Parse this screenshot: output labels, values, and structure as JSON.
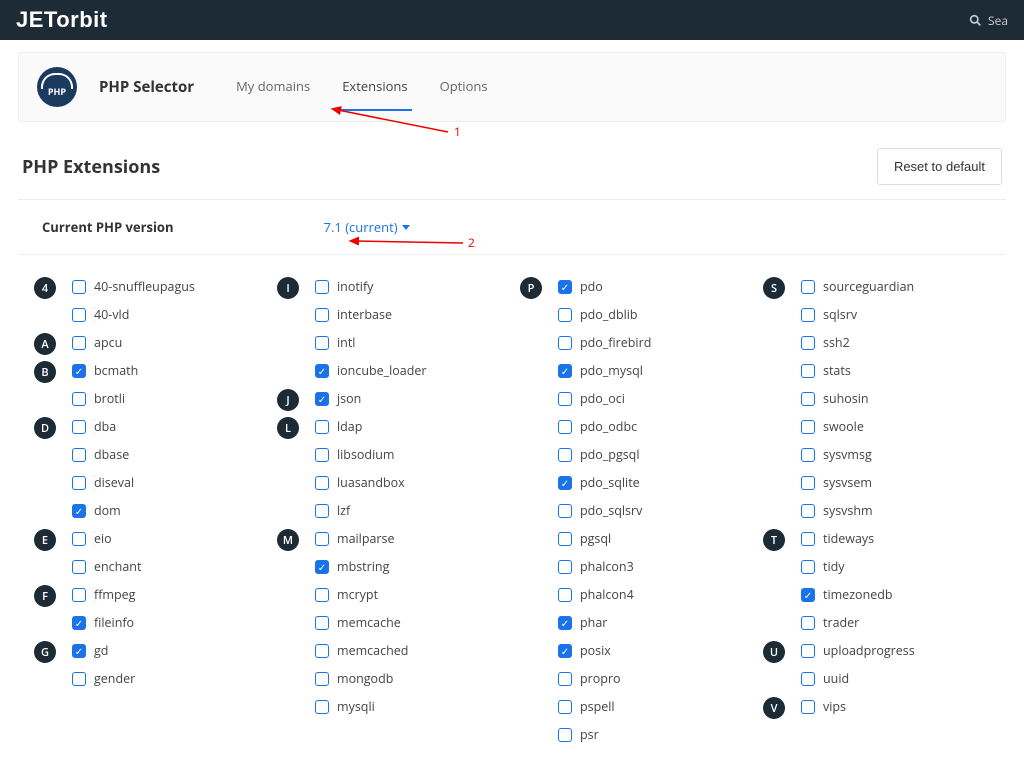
{
  "brand": "JETorbit",
  "search_placeholder": "Sea",
  "app": {
    "icon_text": "PHP",
    "title": "PHP Selector",
    "tabs": [
      {
        "label": "My domains",
        "active": false
      },
      {
        "label": "Extensions",
        "active": true
      },
      {
        "label": "Options",
        "active": false
      }
    ]
  },
  "page": {
    "title": "PHP Extensions",
    "reset_button": "Reset to default"
  },
  "version": {
    "label": "Current PHP version",
    "value": "7.1 (current)"
  },
  "annotations": {
    "a1": "1",
    "a2": "2"
  },
  "columns": [
    [
      {
        "letter": "4",
        "items": [
          {
            "name": "40-snuffleupagus",
            "checked": false
          },
          {
            "name": "40-vld",
            "checked": false
          }
        ]
      },
      {
        "letter": "A",
        "items": [
          {
            "name": "apcu",
            "checked": false
          }
        ]
      },
      {
        "letter": "B",
        "items": [
          {
            "name": "bcmath",
            "checked": true
          },
          {
            "name": "brotli",
            "checked": false
          }
        ]
      },
      {
        "letter": "D",
        "items": [
          {
            "name": "dba",
            "checked": false
          },
          {
            "name": "dbase",
            "checked": false
          },
          {
            "name": "diseval",
            "checked": false
          },
          {
            "name": "dom",
            "checked": true
          }
        ]
      },
      {
        "letter": "E",
        "items": [
          {
            "name": "eio",
            "checked": false
          },
          {
            "name": "enchant",
            "checked": false
          }
        ]
      },
      {
        "letter": "F",
        "items": [
          {
            "name": "ffmpeg",
            "checked": false
          },
          {
            "name": "fileinfo",
            "checked": true
          }
        ]
      },
      {
        "letter": "G",
        "items": [
          {
            "name": "gd",
            "checked": true
          },
          {
            "name": "gender",
            "checked": false
          }
        ]
      }
    ],
    [
      {
        "letter": "I",
        "items": [
          {
            "name": "inotify",
            "checked": false
          },
          {
            "name": "interbase",
            "checked": false
          },
          {
            "name": "intl",
            "checked": false
          },
          {
            "name": "ioncube_loader",
            "checked": true
          }
        ]
      },
      {
        "letter": "J",
        "items": [
          {
            "name": "json",
            "checked": true
          }
        ]
      },
      {
        "letter": "L",
        "items": [
          {
            "name": "ldap",
            "checked": false
          },
          {
            "name": "libsodium",
            "checked": false
          },
          {
            "name": "luasandbox",
            "checked": false
          },
          {
            "name": "lzf",
            "checked": false
          }
        ]
      },
      {
        "letter": "M",
        "items": [
          {
            "name": "mailparse",
            "checked": false
          },
          {
            "name": "mbstring",
            "checked": true
          },
          {
            "name": "mcrypt",
            "checked": false
          },
          {
            "name": "memcache",
            "checked": false
          },
          {
            "name": "memcached",
            "checked": false
          },
          {
            "name": "mongodb",
            "checked": false
          },
          {
            "name": "mysqli",
            "checked": false
          }
        ]
      }
    ],
    [
      {
        "letter": "P",
        "items": [
          {
            "name": "pdo",
            "checked": true
          },
          {
            "name": "pdo_dblib",
            "checked": false
          },
          {
            "name": "pdo_firebird",
            "checked": false
          },
          {
            "name": "pdo_mysql",
            "checked": true
          },
          {
            "name": "pdo_oci",
            "checked": false
          },
          {
            "name": "pdo_odbc",
            "checked": false
          },
          {
            "name": "pdo_pgsql",
            "checked": false
          },
          {
            "name": "pdo_sqlite",
            "checked": true
          },
          {
            "name": "pdo_sqlsrv",
            "checked": false
          },
          {
            "name": "pgsql",
            "checked": false
          },
          {
            "name": "phalcon3",
            "checked": false
          },
          {
            "name": "phalcon4",
            "checked": false
          },
          {
            "name": "phar",
            "checked": true
          },
          {
            "name": "posix",
            "checked": true
          },
          {
            "name": "propro",
            "checked": false
          },
          {
            "name": "pspell",
            "checked": false
          },
          {
            "name": "psr",
            "checked": false
          }
        ]
      }
    ],
    [
      {
        "letter": "S",
        "items": [
          {
            "name": "sourceguardian",
            "checked": false
          },
          {
            "name": "sqlsrv",
            "checked": false
          },
          {
            "name": "ssh2",
            "checked": false
          },
          {
            "name": "stats",
            "checked": false
          },
          {
            "name": "suhosin",
            "checked": false
          },
          {
            "name": "swoole",
            "checked": false
          },
          {
            "name": "sysvmsg",
            "checked": false
          },
          {
            "name": "sysvsem",
            "checked": false
          },
          {
            "name": "sysvshm",
            "checked": false
          }
        ]
      },
      {
        "letter": "T",
        "items": [
          {
            "name": "tideways",
            "checked": false
          },
          {
            "name": "tidy",
            "checked": false
          },
          {
            "name": "timezonedb",
            "checked": true
          },
          {
            "name": "trader",
            "checked": false
          }
        ]
      },
      {
        "letter": "U",
        "items": [
          {
            "name": "uploadprogress",
            "checked": false
          },
          {
            "name": "uuid",
            "checked": false
          }
        ]
      },
      {
        "letter": "V",
        "items": [
          {
            "name": "vips",
            "checked": false
          }
        ]
      }
    ]
  ]
}
